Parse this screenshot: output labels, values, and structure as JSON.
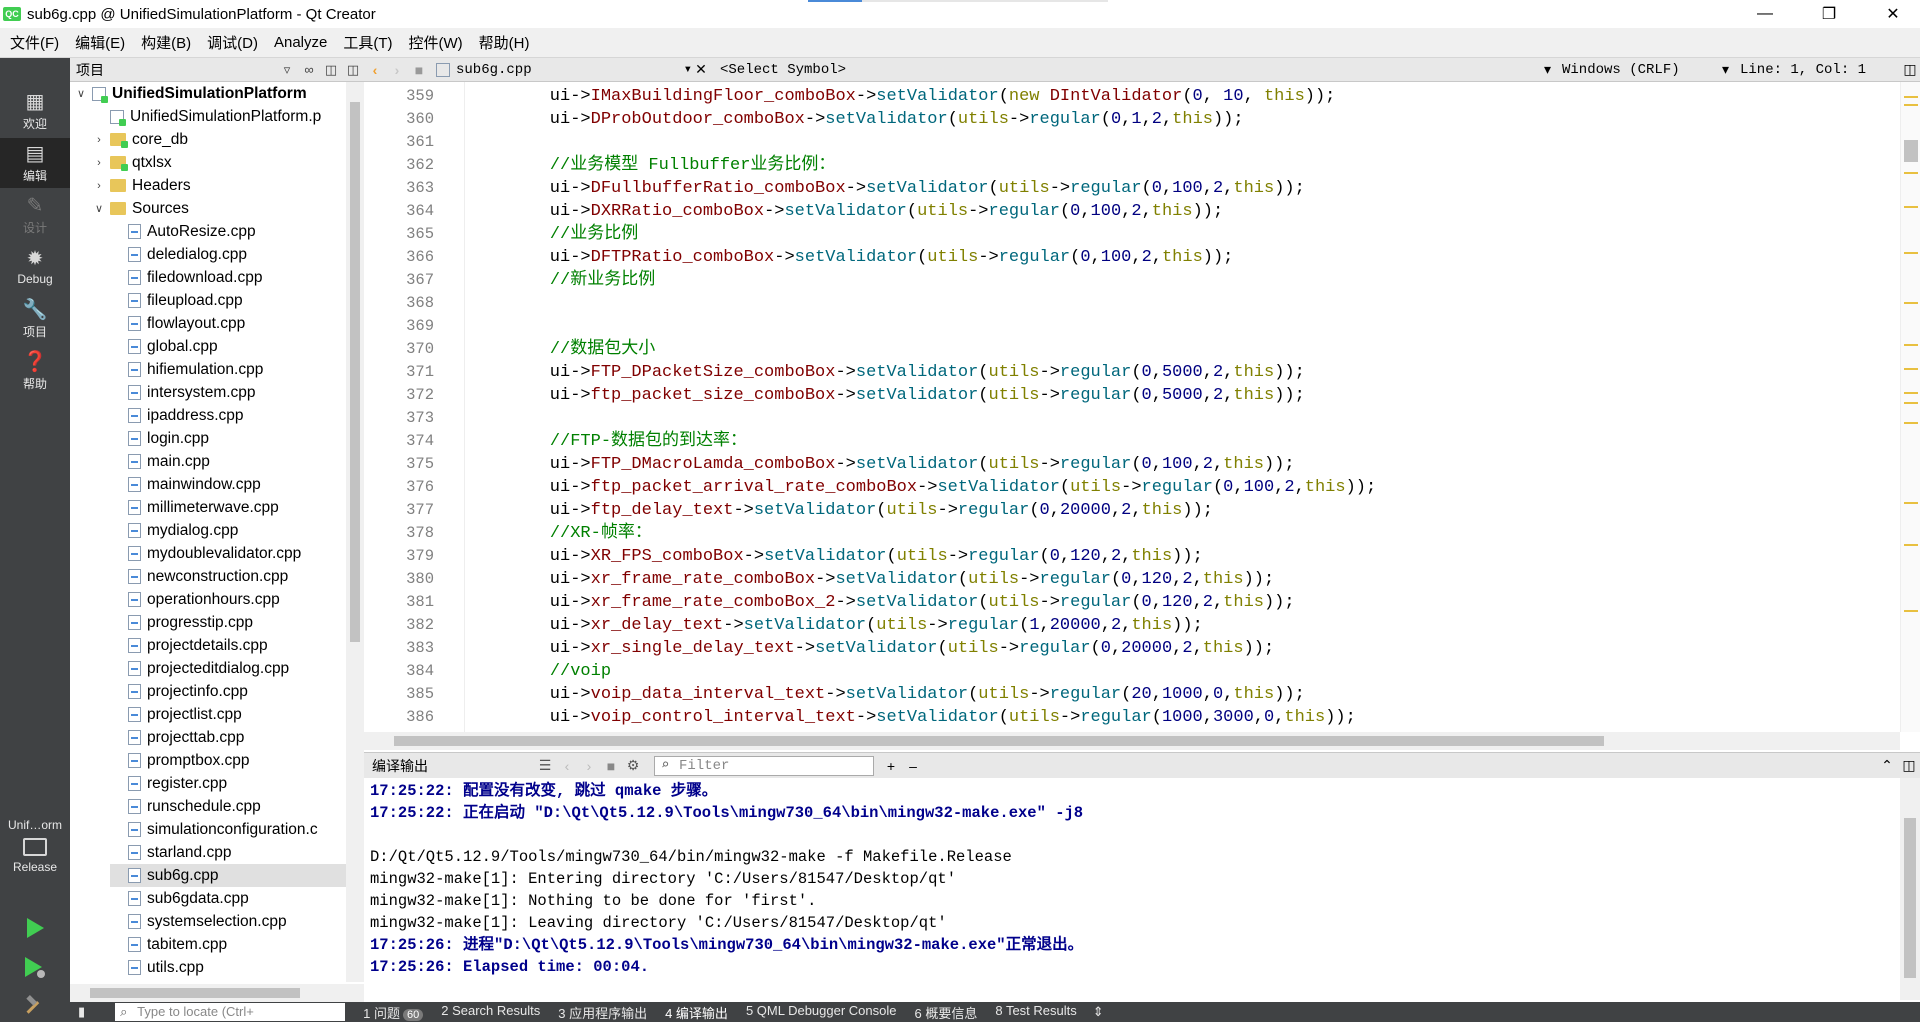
{
  "window": {
    "title": "sub6g.cpp @ UnifiedSimulationPlatform - Qt Creator",
    "app_icon": "QC",
    "controls": [
      "minimize-icon",
      "restore-icon",
      "close-icon"
    ]
  },
  "menu": [
    "文件(F)",
    "编辑(E)",
    "构建(B)",
    "调试(D)",
    "Analyze",
    "工具(T)",
    "控件(W)",
    "帮助(H)"
  ],
  "modes": [
    {
      "label": "欢迎",
      "icon": "grid-icon"
    },
    {
      "label": "编辑",
      "icon": "edit-icon",
      "active": true
    },
    {
      "label": "设计",
      "icon": "pencil-icon",
      "disabled": true
    },
    {
      "label": "Debug",
      "icon": "bug-icon"
    },
    {
      "label": "项目",
      "icon": "wrench-icon"
    },
    {
      "label": "帮助",
      "icon": "help-icon"
    }
  ],
  "kit": {
    "project": "Unif…orm",
    "config": "Release"
  },
  "sidebar": {
    "title": "项目",
    "root": "UnifiedSimulationPlatform",
    "pro_file": "UnifiedSimulationPlatform.p",
    "folders": [
      "core_db",
      "qtxlsx",
      "Headers"
    ],
    "sources_label": "Sources",
    "sources": [
      "AutoResize.cpp",
      "deledialog.cpp",
      "filedownload.cpp",
      "fileupload.cpp",
      "flowlayout.cpp",
      "global.cpp",
      "hifiemulation.cpp",
      "intersystem.cpp",
      "ipaddress.cpp",
      "login.cpp",
      "main.cpp",
      "mainwindow.cpp",
      "millimeterwave.cpp",
      "mydialog.cpp",
      "mydoublevalidator.cpp",
      "newconstruction.cpp",
      "operationhours.cpp",
      "progresstip.cpp",
      "projectdetails.cpp",
      "projecteditdialog.cpp",
      "projectinfo.cpp",
      "projectlist.cpp",
      "projecttab.cpp",
      "promptbox.cpp",
      "register.cpp",
      "runschedule.cpp",
      "simulationconfiguration.c",
      "starland.cpp",
      "sub6g.cpp",
      "sub6gdata.cpp",
      "systemselection.cpp",
      "tabitem.cpp",
      "utils.cpp"
    ],
    "selected": "sub6g.cpp"
  },
  "editor": {
    "file": "sub6g.cpp",
    "symbol": "<Select Symbol>",
    "encoding": "Windows (CRLF)",
    "position": "Line: 1, Col: 1",
    "lines": [
      {
        "n": "359",
        "t": "    ui->IMaxBuildingFloor_comboBox->setValidator(new DIntValidator(0, 10, this));"
      },
      {
        "n": "360",
        "t": "    ui->DProbOutdoor_comboBox->setValidator(utils->regular(0,1,2,this));"
      },
      {
        "n": "361",
        "t": ""
      },
      {
        "n": "362",
        "t": "    //业务模型 Fullbuffer业务比例："
      },
      {
        "n": "363",
        "t": "    ui->DFullbufferRatio_comboBox->setValidator(utils->regular(0,100,2,this));"
      },
      {
        "n": "364",
        "t": "    ui->DXRRatio_comboBox->setValidator(utils->regular(0,100,2,this));"
      },
      {
        "n": "365",
        "t": "    //业务比例"
      },
      {
        "n": "366",
        "t": "    ui->DFTPRatio_comboBox->setValidator(utils->regular(0,100,2,this));"
      },
      {
        "n": "367",
        "t": "    //新业务比例"
      },
      {
        "n": "368",
        "t": ""
      },
      {
        "n": "369",
        "t": ""
      },
      {
        "n": "370",
        "t": "    //数据包大小"
      },
      {
        "n": "371",
        "t": "    ui->FTP_DPacketSize_comboBox->setValidator(utils->regular(0,5000,2,this));"
      },
      {
        "n": "372",
        "t": "    ui->ftp_packet_size_comboBox->setValidator(utils->regular(0,5000,2,this));"
      },
      {
        "n": "373",
        "t": ""
      },
      {
        "n": "374",
        "t": "    //FTP-数据包的到达率："
      },
      {
        "n": "375",
        "t": "    ui->FTP_DMacroLamda_comboBox->setValidator(utils->regular(0,100,2,this));"
      },
      {
        "n": "376",
        "t": "    ui->ftp_packet_arrival_rate_comboBox->setValidator(utils->regular(0,100,2,this));"
      },
      {
        "n": "377",
        "t": "    ui->ftp_delay_text->setValidator(utils->regular(0,20000,2,this));"
      },
      {
        "n": "378",
        "t": "    //XR-帧率："
      },
      {
        "n": "379",
        "t": "    ui->XR_FPS_comboBox->setValidator(utils->regular(0,120,2,this));"
      },
      {
        "n": "380",
        "t": "    ui->xr_frame_rate_comboBox->setValidator(utils->regular(0,120,2,this));"
      },
      {
        "n": "381",
        "t": "    ui->xr_frame_rate_comboBox_2->setValidator(utils->regular(0,120,2,this));"
      },
      {
        "n": "382",
        "t": "    ui->xr_delay_text->setValidator(utils->regular(1,20000,2,this));"
      },
      {
        "n": "383",
        "t": "    ui->xr_single_delay_text->setValidator(utils->regular(0,20000,2,this));"
      },
      {
        "n": "384",
        "t": "    //voip"
      },
      {
        "n": "385",
        "t": "    ui->voip_data_interval_text->setValidator(utils->regular(20,1000,0,this));"
      },
      {
        "n": "386",
        "t": "    ui->voip_control_interval_text->setValidator(utils->regular(1000,3000,0,this));"
      }
    ]
  },
  "output": {
    "title": "编译输出",
    "filter_placeholder": "Filter",
    "lines": [
      {
        "t": "17:25:22: 配置没有改变, 跳过 qmake 步骤。",
        "bold": true
      },
      {
        "t": "17:25:22: 正在启动 \"D:\\Qt\\Qt5.12.9\\Tools\\mingw730_64\\bin\\mingw32-make.exe\" -j8",
        "bold": true
      },
      {
        "t": "",
        "bold": false
      },
      {
        "t": "D:/Qt/Qt5.12.9/Tools/mingw730_64/bin/mingw32-make -f Makefile.Release",
        "bold": false
      },
      {
        "t": "mingw32-make[1]: Entering directory 'C:/Users/81547/Desktop/qt'",
        "bold": false
      },
      {
        "t": "mingw32-make[1]: Nothing to be done for 'first'.",
        "bold": false
      },
      {
        "t": "mingw32-make[1]: Leaving directory 'C:/Users/81547/Desktop/qt'",
        "bold": false
      },
      {
        "t": "17:25:26: 进程\"D:\\Qt\\Qt5.12.9\\Tools\\mingw730_64\\bin\\mingw32-make.exe\"正常退出。",
        "bold": true
      },
      {
        "t": "17:25:26: Elapsed time: 00:04.",
        "bold": true
      }
    ]
  },
  "statusbar": {
    "locator_placeholder": "Type to locate (Ctrl+",
    "panes": [
      {
        "label": "1 问题",
        "badge": "60"
      },
      {
        "label": "2 Search Results"
      },
      {
        "label": "3 应用程序输出"
      },
      {
        "label": "4 编译输出",
        "active": true
      },
      {
        "label": "5 QML Debugger Console"
      },
      {
        "label": "6 概要信息"
      },
      {
        "label": "8 Test Results"
      }
    ]
  },
  "colors": {
    "sidebar": "#404244",
    "accent": "#41cd52",
    "comment": "#008000",
    "keyword": "#808000",
    "function": "#00677c",
    "member": "#800000",
    "number": "#000080",
    "output_bold": "#00008b"
  }
}
